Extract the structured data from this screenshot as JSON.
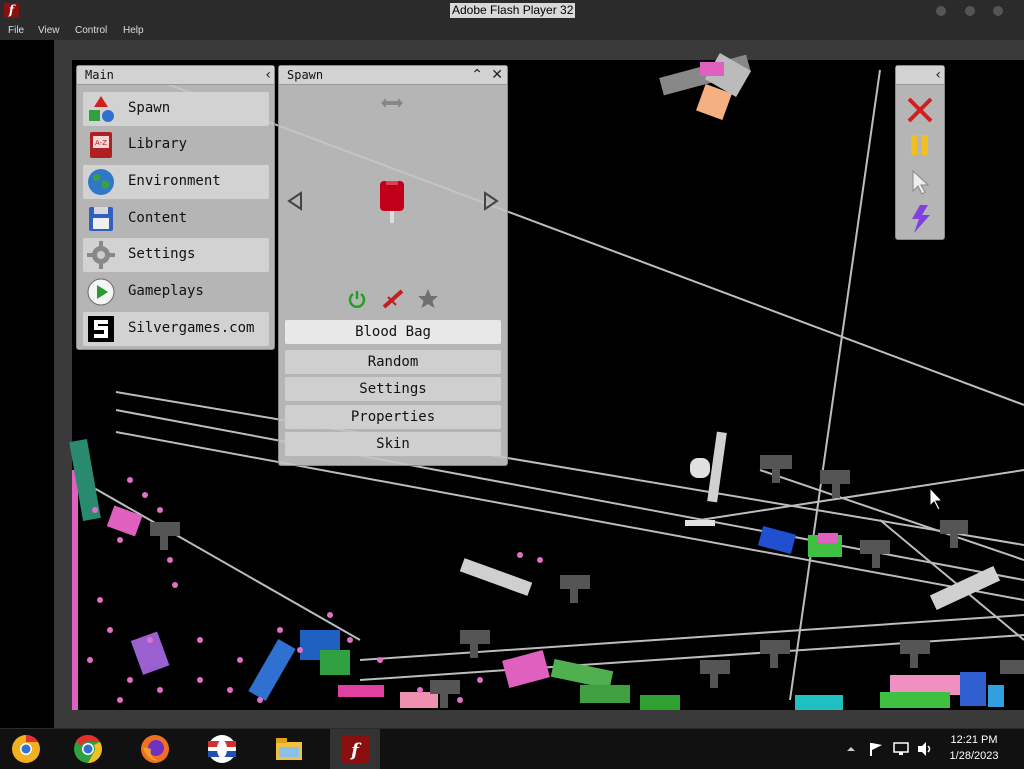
{
  "window": {
    "title": "Adobe Flash Player 32"
  },
  "menu": {
    "file": "File",
    "view": "View",
    "control": "Control",
    "help": "Help"
  },
  "main_panel": {
    "title": "Main",
    "items": [
      {
        "label": "Spawn",
        "icon": "spawn-shapes-icon"
      },
      {
        "label": "Library",
        "icon": "library-book-icon"
      },
      {
        "label": "Environment",
        "icon": "globe-icon"
      },
      {
        "label": "Content",
        "icon": "floppy-disk-icon"
      },
      {
        "label": "Settings",
        "icon": "gear-icon"
      },
      {
        "label": "Gameplays",
        "icon": "play-icon"
      },
      {
        "label": "Silvergames.com",
        "icon": "silvergames-logo-icon"
      }
    ]
  },
  "spawn_panel": {
    "title": "Spawn",
    "selected_item": "Blood Bag",
    "selected_icon": "blood-bag-icon",
    "options": [
      "Random",
      "Settings",
      "Properties",
      "Skin"
    ]
  },
  "toolbar": {
    "tools": [
      "close-x-icon",
      "pause-icon",
      "cursor-icon",
      "lightning-icon"
    ]
  },
  "taskbar": {
    "apps": [
      "chrome-canary-icon",
      "chrome-icon",
      "firefox-icon",
      "opera-icon",
      "file-explorer-icon",
      "flash-player-icon"
    ],
    "time": "12:21 PM",
    "date": "1/28/2023"
  },
  "colors": {
    "panel": "#c4c4c4",
    "stage": "#000000",
    "pink": "#e060c0",
    "blood_red": "#c0001a",
    "toolbar_red": "#d22020",
    "toolbar_yellow": "#f0c020",
    "toolbar_purple": "#8040e0"
  }
}
